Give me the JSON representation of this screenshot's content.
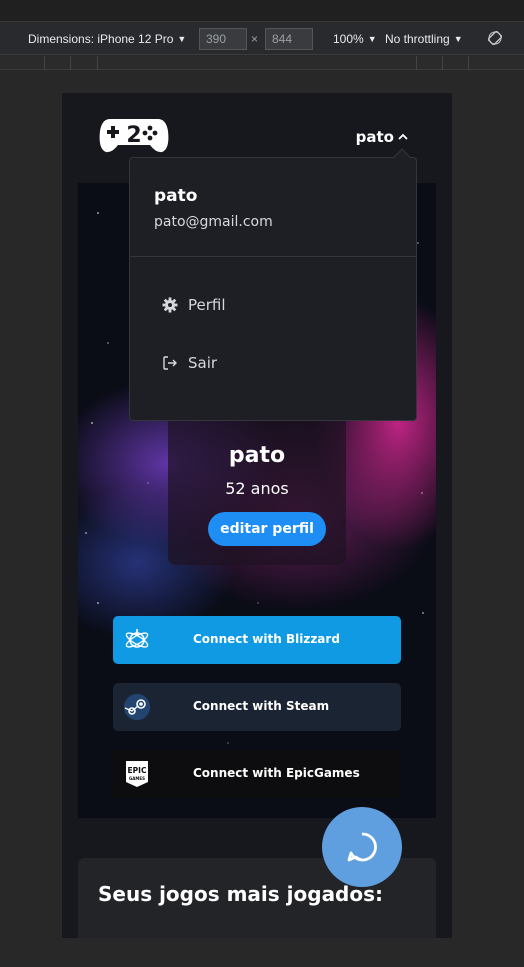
{
  "devtools": {
    "dimensions_label": "Dimensions: iPhone 12 Pro",
    "width_value": "390",
    "times": "×",
    "height_value": "844",
    "zoom": "100%",
    "throttling": "No throttling"
  },
  "header": {
    "logo_icon": "gamepad-2-logo",
    "user_name": "pato"
  },
  "dropdown": {
    "name": "pato",
    "email": "pato@gmail.com",
    "items": [
      {
        "label": "Perfil",
        "icon": "gear-icon"
      },
      {
        "label": "Sair",
        "icon": "logout-icon"
      }
    ]
  },
  "profile": {
    "name": "pato",
    "age": "52 anos",
    "edit_label": "editar perfil"
  },
  "connections": [
    {
      "label": "Connect with Blizzard",
      "icon": "blizzard-icon",
      "color": "#0f9ae3"
    },
    {
      "label": "Connect with Steam",
      "icon": "steam-icon",
      "color": "#1b2433"
    },
    {
      "label": "Connect with EpicGames",
      "icon": "epicgames-icon",
      "color": "#0d0d0f"
    }
  ],
  "section": {
    "title": "Seus jogos mais jogados:"
  },
  "chat": {
    "icon": "chat-bubble-icon"
  }
}
